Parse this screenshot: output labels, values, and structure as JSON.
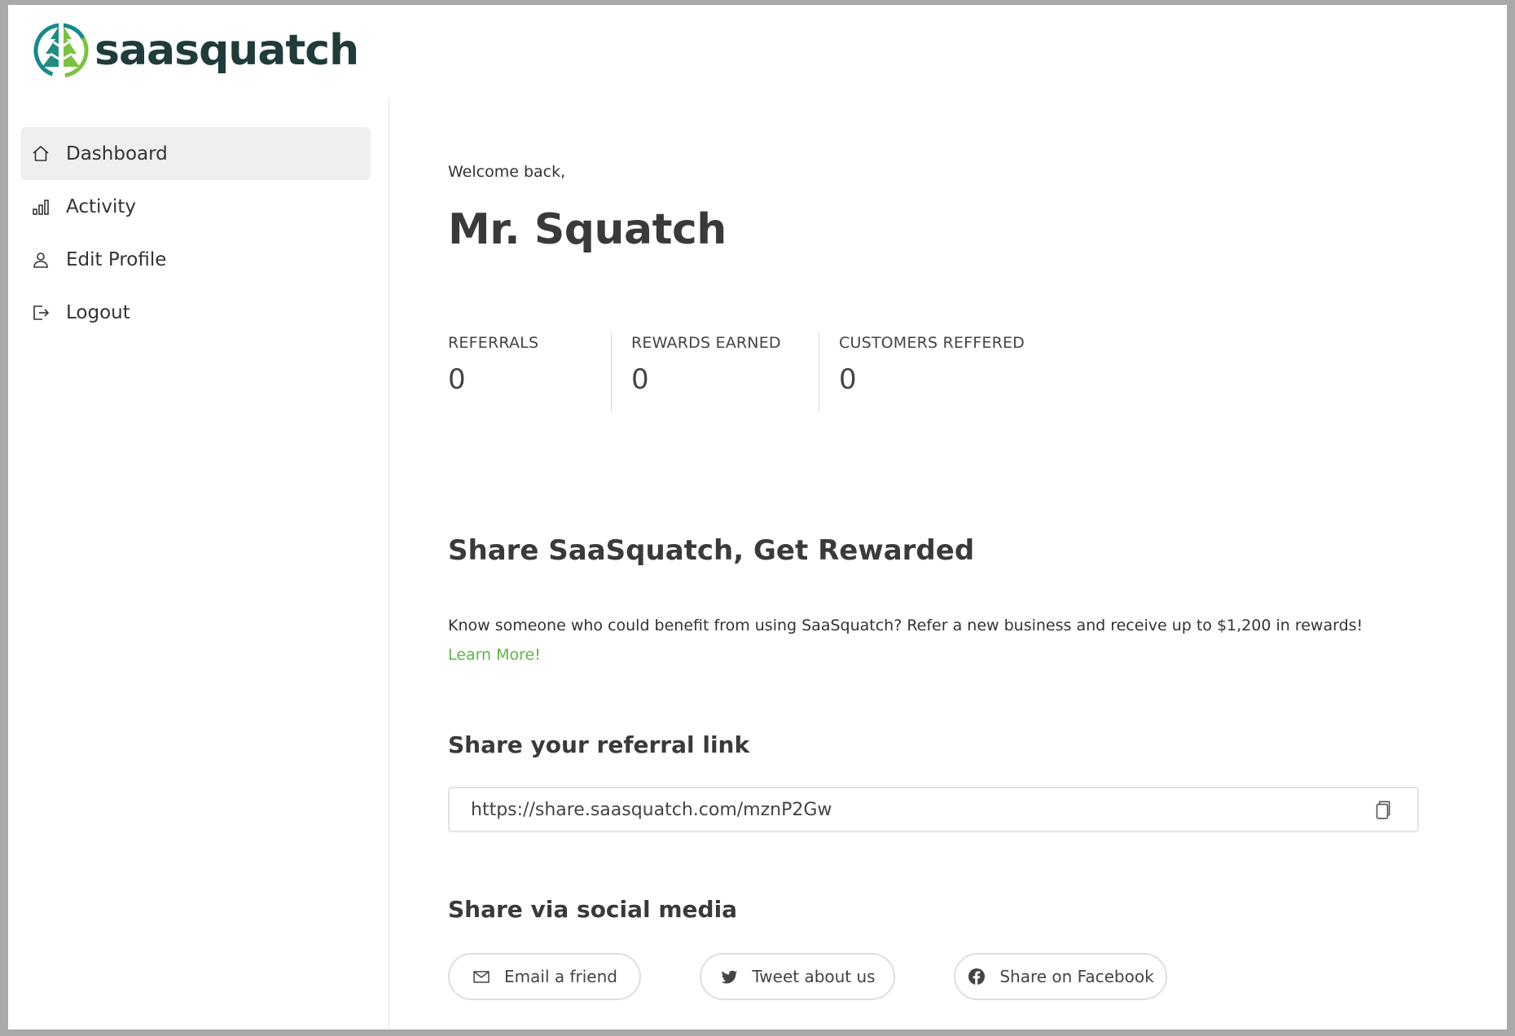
{
  "brand": {
    "name": "saasquatch",
    "logo_color": "#4cb04a"
  },
  "sidebar": {
    "items": [
      {
        "label": "Dashboard",
        "icon": "home-icon",
        "active": true
      },
      {
        "label": "Activity",
        "icon": "bar-chart-icon",
        "active": false
      },
      {
        "label": "Edit Profile",
        "icon": "user-icon",
        "active": false
      },
      {
        "label": "Logout",
        "icon": "logout-icon",
        "active": false
      }
    ]
  },
  "main": {
    "welcome": "Welcome back,",
    "user_name": "Mr. Squatch",
    "stats": [
      {
        "label": "REFERRALS",
        "value": "0"
      },
      {
        "label": "REWARDS EARNED",
        "value": "0"
      },
      {
        "label": "CUSTOMERS REFFERED",
        "value": "0"
      }
    ],
    "share_title": "Share SaaSquatch, Get Rewarded",
    "share_description": "Know someone who could benefit from using SaaSquatch? Refer a new business and receive up to $1,200 in rewards! ",
    "learn_more": "Learn More!",
    "referral_link_title": "Share your referral link",
    "referral_link": "https://share.saasquatch.com/mznP2Gw",
    "social_title": "Share via social media",
    "social_buttons": [
      {
        "label": "Email a friend",
        "icon": "envelope-icon"
      },
      {
        "label": "Tweet about us",
        "icon": "twitter-icon"
      },
      {
        "label": "Share on Facebook",
        "icon": "facebook-icon"
      }
    ],
    "accent_color": "#5bb549"
  }
}
